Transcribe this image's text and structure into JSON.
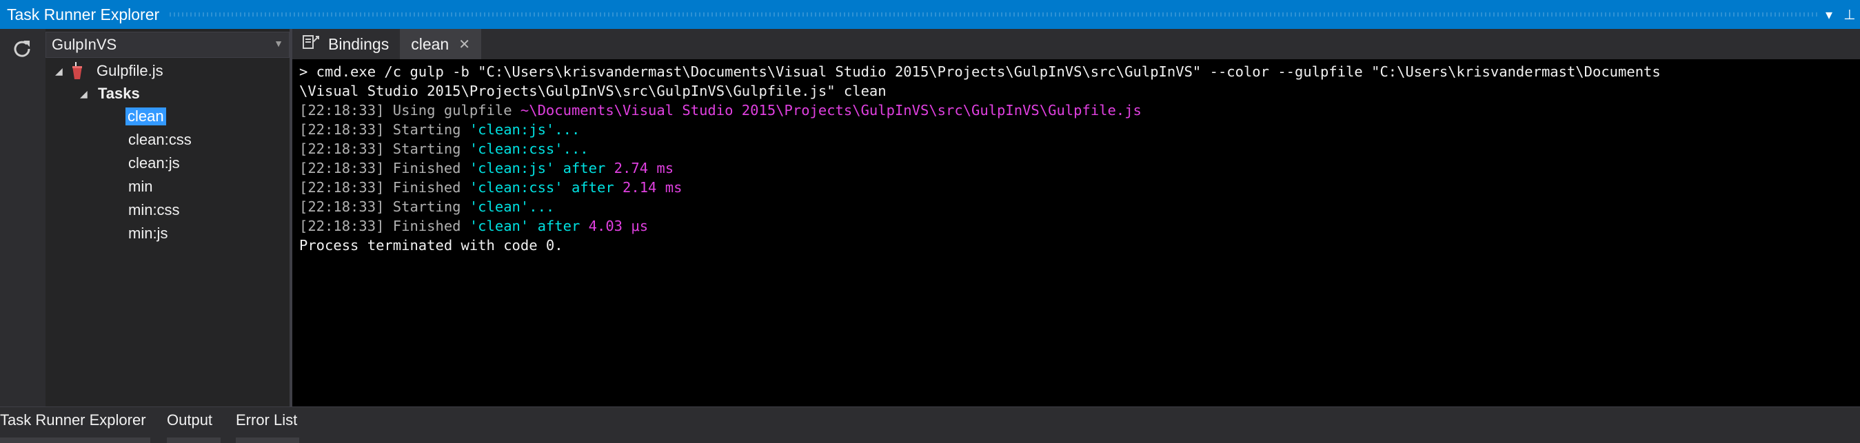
{
  "window": {
    "title": "Task Runner Explorer"
  },
  "toolbar": {
    "refresh_icon": "refresh-icon"
  },
  "project_selector": {
    "value": "GulpInVS"
  },
  "tree": {
    "file": "Gulpfile.js",
    "tasks_label": "Tasks",
    "tasks": [
      "clean",
      "clean:css",
      "clean:js",
      "min",
      "min:css",
      "min:js"
    ],
    "selected": "clean"
  },
  "tabs": {
    "bindings_label": "Bindings",
    "active_label": "clean"
  },
  "console": {
    "command_line_1": "> cmd.exe /c gulp -b \"C:\\Users\\krisvandermast\\Documents\\Visual Studio 2015\\Projects\\GulpInVS\\src\\GulpInVS\" --color --gulpfile \"C:\\Users\\krisvandermast\\Documents",
    "command_line_2": "\\Visual Studio 2015\\Projects\\GulpInVS\\src\\GulpInVS\\Gulpfile.js\" clean",
    "lines": [
      {
        "ts": "[22:18:33]",
        "a": " Using gulpfile ",
        "b": "~\\Documents\\Visual Studio 2015\\Projects\\GulpInVS\\src\\GulpInVS\\Gulpfile.js",
        "c": "",
        "d": ""
      },
      {
        "ts": "[22:18:33]",
        "a": " Starting ",
        "b": "'clean:js'",
        "c": "...",
        "d": ""
      },
      {
        "ts": "[22:18:33]",
        "a": " Starting ",
        "b": "'clean:css'",
        "c": "...",
        "d": ""
      },
      {
        "ts": "[22:18:33]",
        "a": " Finished ",
        "b": "'clean:js'",
        "c": " after ",
        "d": "2.74 ms"
      },
      {
        "ts": "[22:18:33]",
        "a": " Finished ",
        "b": "'clean:css'",
        "c": " after ",
        "d": "2.14 ms"
      },
      {
        "ts": "[22:18:33]",
        "a": " Starting ",
        "b": "'clean'",
        "c": "...",
        "d": ""
      },
      {
        "ts": "[22:18:33]",
        "a": " Finished ",
        "b": "'clean'",
        "c": " after ",
        "d": "4.03 μs"
      }
    ],
    "exit_line": "Process terminated with code 0."
  },
  "bottom_tabs": [
    "Task Runner Explorer",
    "Output",
    "Error List"
  ],
  "colors": {
    "accent": "#007acc",
    "selection": "#3399ff",
    "cyan": "#00e0e0",
    "magenta": "#e040e0"
  }
}
